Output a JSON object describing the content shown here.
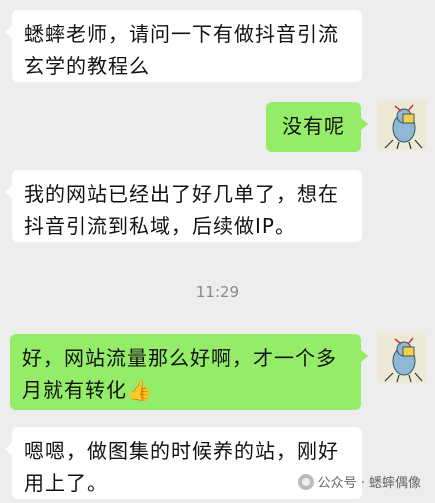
{
  "messages": [
    {
      "id": "m1",
      "side": "in",
      "text": "蟋蟀老师，请问一下有做抖音引流玄学的教程么"
    },
    {
      "id": "m2",
      "side": "out",
      "text": "没有呢"
    },
    {
      "id": "m3",
      "side": "in",
      "text": "我的网站已经出了好几单了，想在抖音引流到私域，后续做IP。"
    },
    {
      "id": "m4",
      "side": "out",
      "text": "好，网站流量那么好啊，才一个多月就有转化👍"
    },
    {
      "id": "m5",
      "side": "in",
      "text": "嗯嗯，做图集的时候养的站，刚好用上了。"
    }
  ],
  "timestamp": "11:29",
  "watermark": {
    "icon": "wechat-official-account-icon",
    "text": "公众号 · 蟋蟀偶像"
  },
  "avatar": {
    "icon": "cartoon-cricket-avatar-icon"
  },
  "colors": {
    "background": "#ededed",
    "incoming_bubble": "#ffffff",
    "outgoing_bubble": "#95ec69",
    "timestamp": "#8a8a8a"
  }
}
